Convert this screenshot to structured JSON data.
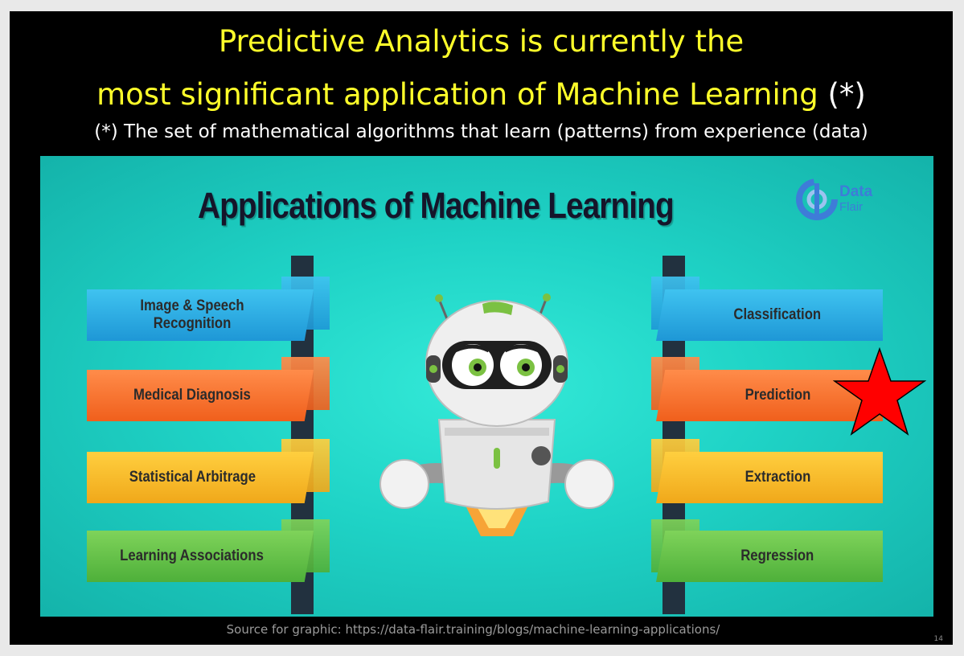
{
  "slide": {
    "title_line1": "Predictive Analytics is currently the",
    "title_line2": "most significant application of Machine Learning",
    "title_asterisk": "(*)",
    "subtitle": "(*) The set of mathematical algorithms that learn (patterns) from experience (data)",
    "source": "Source for graphic:  https://data-flair.training/blogs/machine-learning-applications/",
    "page_number": "14"
  },
  "graphic": {
    "title": "Applications of Machine Learning",
    "logo": {
      "line1": "Data",
      "line2": "Flair",
      "icon": "data-flair-logo-icon"
    },
    "left_items": [
      {
        "label": "Image & Speech Recognition",
        "color": "#2ab0e8"
      },
      {
        "label": "Medical Diagnosis",
        "color": "#f26a2a"
      },
      {
        "label": "Statistical Arbitrage",
        "color": "#f5b324"
      },
      {
        "label": "Learning Associations",
        "color": "#5cbf44"
      }
    ],
    "right_items": [
      {
        "label": "Classification",
        "color": "#2ab0e8"
      },
      {
        "label": "Prediction",
        "color": "#f26a2a",
        "highlighted": true
      },
      {
        "label": "Extraction",
        "color": "#f5b324"
      },
      {
        "label": "Regression",
        "color": "#5cbf44"
      }
    ],
    "highlight_marker": {
      "icon": "red-star-icon",
      "color": "#ff0000"
    }
  }
}
